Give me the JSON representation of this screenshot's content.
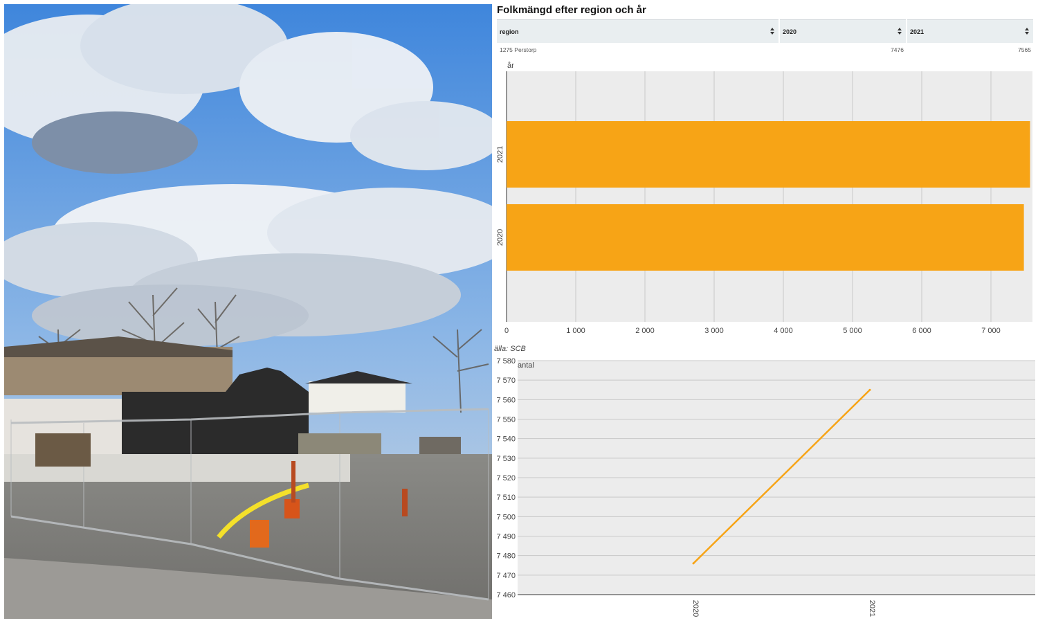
{
  "table": {
    "title": "Folkmängd efter region och år",
    "columns": [
      "region",
      "2020",
      "2021"
    ],
    "rows": [
      [
        "1275 Perstorp",
        "7476",
        "7565"
      ]
    ]
  },
  "source": "älla: SCB",
  "colors": {
    "series": "#f7a416",
    "panel": "#ececec",
    "grid": "#c8c8c8"
  },
  "chart_data": [
    {
      "type": "bar",
      "orientation": "horizontal",
      "ylabel": "år",
      "categories": [
        "2021",
        "2020"
      ],
      "values": [
        7565,
        7476
      ],
      "xlim": [
        0,
        7600
      ],
      "xticks": [
        0,
        1000,
        2000,
        3000,
        4000,
        5000,
        6000,
        7000
      ],
      "xtick_labels": [
        "0",
        "1 000",
        "2 000",
        "3 000",
        "4 000",
        "5 000",
        "6 000",
        "7 000"
      ]
    },
    {
      "type": "line",
      "ylabel": "antal",
      "x": [
        "2020",
        "2021"
      ],
      "values": [
        7476,
        7565
      ],
      "ylim": [
        7460,
        7580
      ],
      "yticks": [
        7460,
        7470,
        7480,
        7490,
        7500,
        7510,
        7520,
        7530,
        7540,
        7550,
        7560,
        7570,
        7580
      ],
      "ytick_labels": [
        "7 460",
        "7 470",
        "7 480",
        "7 490",
        "7 500",
        "7 510",
        "7 520",
        "7 530",
        "7 540",
        "7 550",
        "7 560",
        "7 570",
        "7 580"
      ]
    }
  ]
}
